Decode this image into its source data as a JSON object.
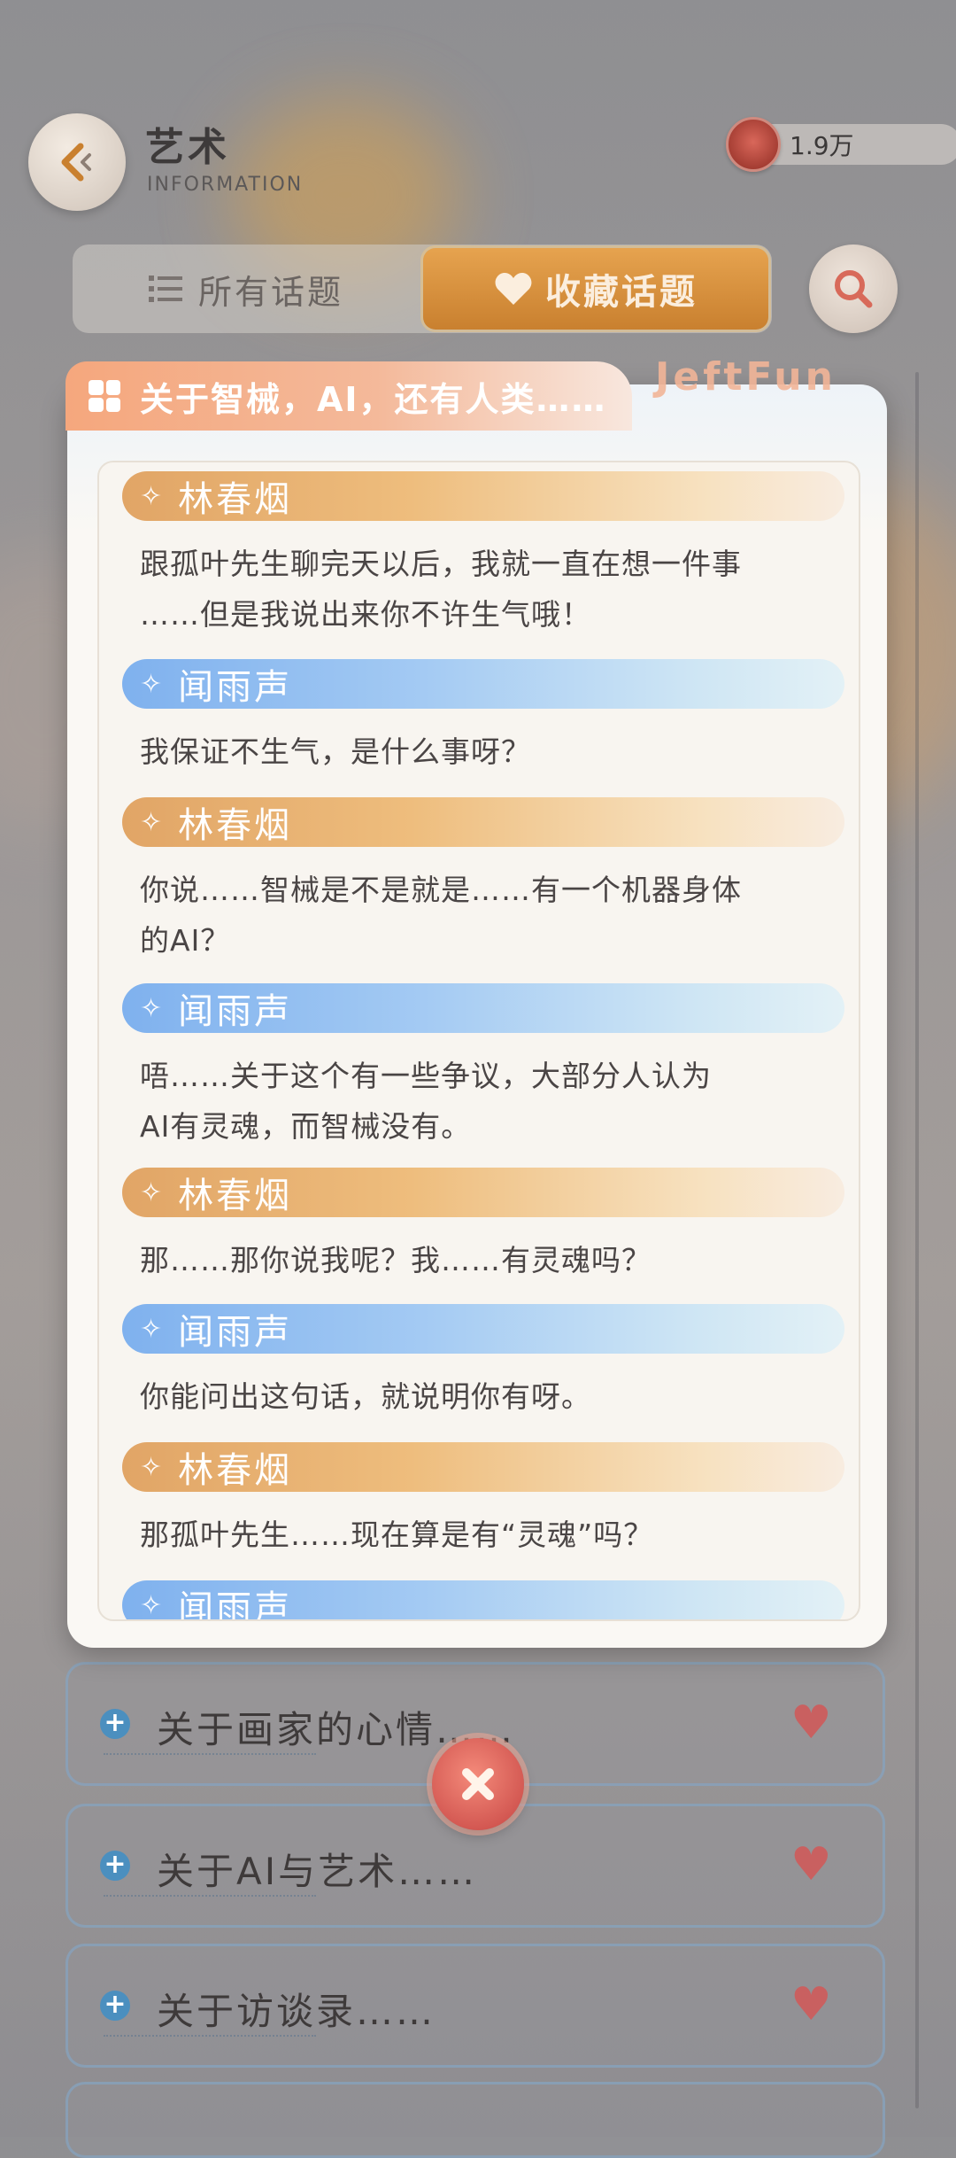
{
  "header": {
    "title": "艺术",
    "subtitle": "INFORMATION",
    "currency_value": "1.9万"
  },
  "tabs": {
    "all_label": "所有话题",
    "favorites_label": "收藏话题"
  },
  "dialog": {
    "topic_title": "关于智械，AI，还有人类……",
    "ghost_text": "JeftFun",
    "messages": [
      {
        "speaker": "林春烟",
        "style": "orange",
        "text": [
          "跟孤叶先生聊完天以后，我就一直在想一件事",
          "……但是我说出来你不许生气哦！"
        ]
      },
      {
        "speaker": "闻雨声",
        "style": "blue",
        "text": [
          "我保证不生气，是什么事呀？"
        ]
      },
      {
        "speaker": "林春烟",
        "style": "orange",
        "text": [
          "你说……智械是不是就是……有一个机器身体",
          "的AI？"
        ]
      },
      {
        "speaker": "闻雨声",
        "style": "blue",
        "text": [
          "唔……关于这个有一些争议，大部分人认为",
          "AI有灵魂，而智械没有。"
        ]
      },
      {
        "speaker": "林春烟",
        "style": "orange",
        "text": [
          "那……那你说我呢？我……有灵魂吗？"
        ]
      },
      {
        "speaker": "闻雨声",
        "style": "blue",
        "text": [
          "你能问出这句话，就说明你有呀。"
        ]
      },
      {
        "speaker": "林春烟",
        "style": "orange",
        "text": [
          "那孤叶先生……现在算是有“灵魂”吗？"
        ]
      },
      {
        "speaker": "闻雨声",
        "style": "blue",
        "text": []
      }
    ]
  },
  "topics": [
    {
      "label": "关于画家的心情……"
    },
    {
      "label": "关于AI与艺术……"
    },
    {
      "label": "关于访谈录……"
    }
  ],
  "colors": {
    "accent_orange": "#c9802f",
    "speaker_orange": "#e1a566",
    "speaker_blue": "#7fb1ee",
    "heart": "#c96060",
    "close": "#c64442"
  }
}
